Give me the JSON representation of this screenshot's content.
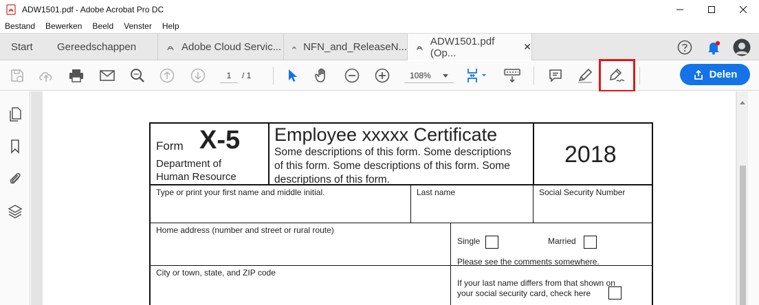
{
  "window": {
    "title": "ADW1501.pdf  - Adobe Acrobat Pro DC"
  },
  "menu": [
    "Bestand",
    "Bewerken",
    "Beeld",
    "Venster",
    "Help"
  ],
  "tabs": {
    "home": "Start",
    "tools": "Gereedschappen",
    "docs": [
      {
        "label": "Adobe Cloud Servic..."
      },
      {
        "label": "NFN_and_ReleaseN..."
      },
      {
        "label": "ADW1501.pdf (Op..."
      }
    ],
    "close_glyph": "✕"
  },
  "toolbar": {
    "current_page": "1",
    "total_pages": "/  1",
    "zoom": "108%",
    "share_label": "Delen"
  },
  "colors": {
    "accent": "#1473e6",
    "highlight": "#e0161b",
    "notification": "#e0161b"
  },
  "form": {
    "form_word": "Form",
    "form_number": "X-5",
    "department": "Department of",
    "department2": "Human Resource",
    "title": "Employee xxxxx Certificate",
    "description_lines": [
      "Some descriptions of this form. Some descriptions",
      "of this form. Some descriptions of this form. Some",
      "descriptions of this form."
    ],
    "year": "2018",
    "first_name_label": "Type or print your first name and middle initial.",
    "last_name_label": "Last name",
    "ssn_label": "Social Security Number",
    "home_address_label": "Home address (number and street or rural route)",
    "single_label": "Single",
    "married_label": "Married",
    "comments_note": "Please see the comments somewhere.",
    "city_label": "City or town, state, and ZIP code",
    "last_name_differs_line1": "If your last name differs from that shown on",
    "last_name_differs_line2": "your social security card, check here"
  }
}
